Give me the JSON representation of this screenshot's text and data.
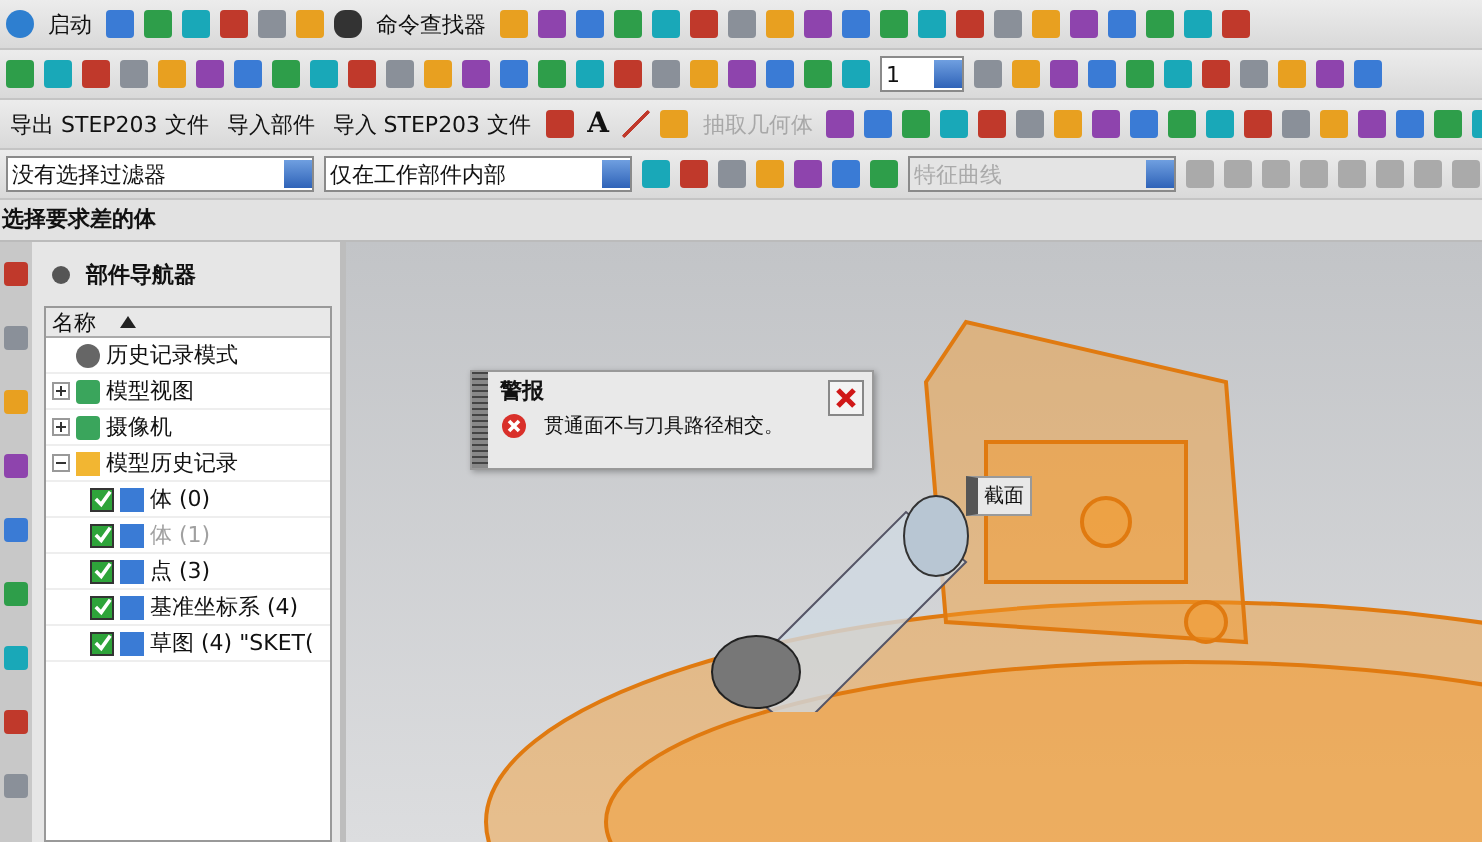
{
  "toolbar": {
    "start_label": "启动",
    "command_finder": "命令查找器",
    "layer_value": "1",
    "text_buttons": [
      {
        "label": "导出 STEP203 文件",
        "disabled": false
      },
      {
        "label": "导入部件",
        "disabled": false
      },
      {
        "label": "导入 STEP203 文件",
        "disabled": false
      },
      {
        "label": "抽取几何体",
        "disabled": true
      }
    ],
    "text_tool": "A",
    "selection_filter": "没有选择过滤器",
    "scope_filter": "仅在工作部件内部",
    "curve_rule": "特征曲线",
    "curve_rule_disabled": true
  },
  "prompt": "选择要求差的体",
  "navigator": {
    "title": "部件导航器",
    "column": "名称",
    "items": [
      {
        "kind": "leaf",
        "label": "历史记录模式"
      },
      {
        "kind": "node",
        "label": "模型视图",
        "expanded": false
      },
      {
        "kind": "node",
        "label": "摄像机",
        "expanded": false
      },
      {
        "kind": "node",
        "label": "模型历史记录",
        "expanded": true,
        "children": [
          {
            "label": "体 (0)",
            "checked": true,
            "disabled": false
          },
          {
            "label": "体 (1)",
            "checked": true,
            "disabled": true
          },
          {
            "label": "点 (3)",
            "checked": true,
            "disabled": false
          },
          {
            "label": "基准坐标系 (4)",
            "checked": true,
            "disabled": false
          },
          {
            "label": "草图 (4) \"SKET(",
            "checked": true,
            "disabled": false
          }
        ]
      }
    ]
  },
  "alert": {
    "title": "警报",
    "message": "贯通面不与刀具路径相交。"
  },
  "viewport_label": "截面"
}
